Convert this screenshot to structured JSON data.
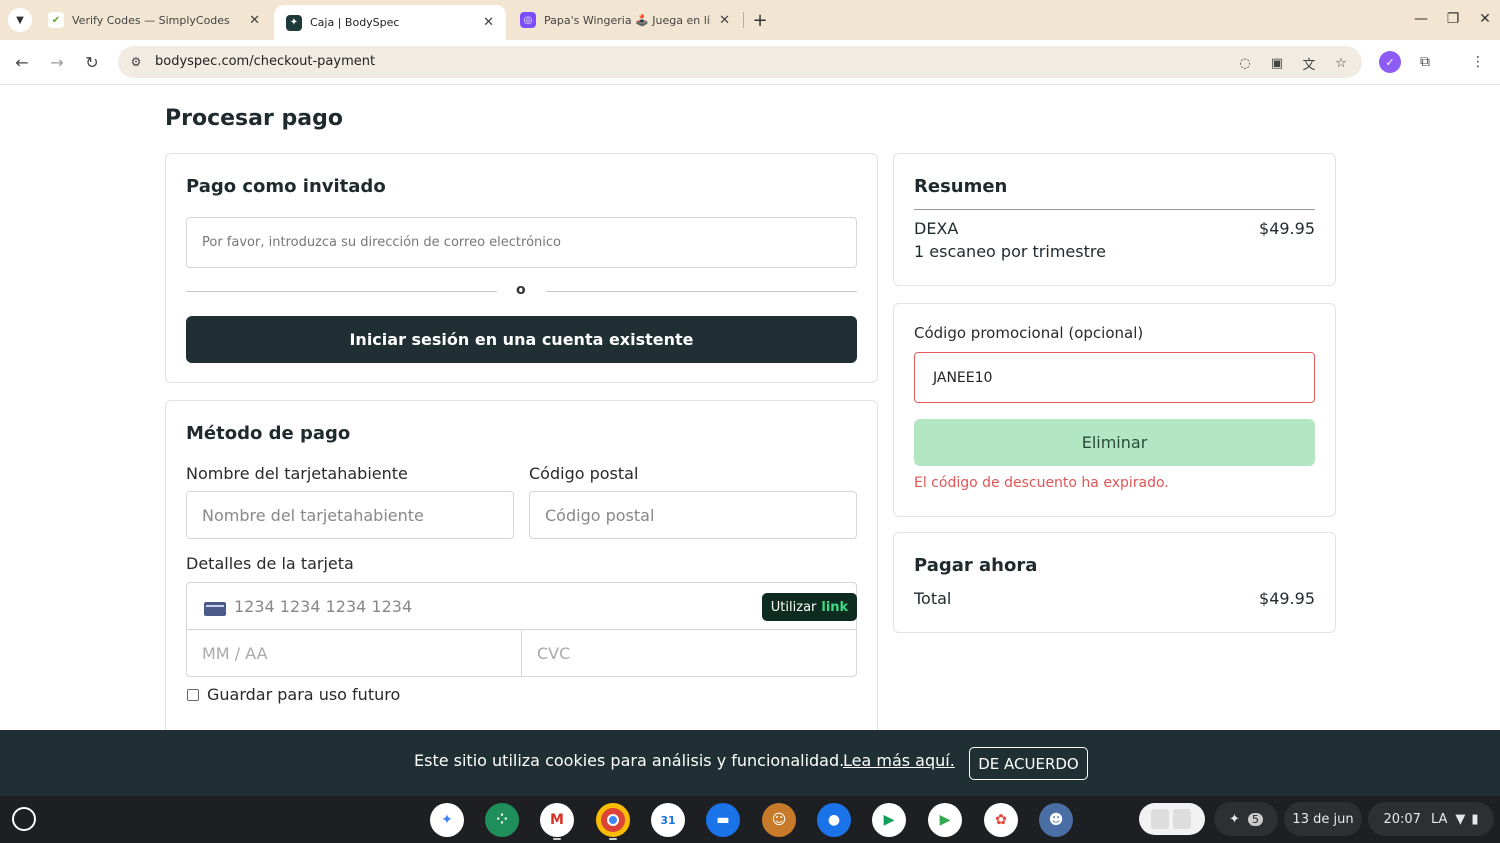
{
  "browser": {
    "tabs": [
      {
        "title": "Verify Codes — SimplyCodes",
        "icon": "simplycodes-icon",
        "icon_color": "#8bc34a",
        "active": false
      },
      {
        "title": "Caja | BodySpec",
        "icon": "bodyspec-icon",
        "icon_color": "#1f3a3a",
        "active": true
      },
      {
        "title": "Papa's Wingeria 🕹️ Juega en línea",
        "icon": "game-icon",
        "icon_color": "#7c4dff",
        "active": false
      }
    ],
    "url": "bodyspec.com/checkout-payment"
  },
  "page": {
    "title": "Procesar pago",
    "guest": {
      "title": "Pago como invitado",
      "email_placeholder": "Por favor, introduzca su dirección de correo electrónico",
      "or": "o",
      "login_button": "Iniciar sesión en una cuenta existente"
    },
    "payment": {
      "title": "Método de pago",
      "cardholder_label": "Nombre del tarjetahabiente",
      "cardholder_placeholder": "Nombre del tarjetahabiente",
      "postal_label": "Código postal",
      "postal_placeholder": "Código postal",
      "card_details_label": "Detalles de la tarjeta",
      "card_number_placeholder": "1234 1234 1234 1234",
      "link_button_prefix": "Utilizar",
      "link_button_word": "link",
      "expiry_placeholder": "MM / AA",
      "cvc_placeholder": "CVC",
      "save_label": "Guardar para uso futuro"
    },
    "summary": {
      "title": "Resumen",
      "item_name": "DEXA",
      "item_desc": "1 escaneo por trimestre",
      "item_price": "$49.95"
    },
    "promo": {
      "label": "Código promocional (opcional)",
      "value": "JANEE10",
      "remove_button": "Eliminar",
      "error": "El código de descuento ha expirado."
    },
    "pay_now": {
      "title": "Pagar ahora",
      "total_label": "Total",
      "total_value": "$49.95"
    }
  },
  "cookie_banner": {
    "text": "Este sitio utiliza cookies para análisis y funcionalidad.",
    "link": "Lea más aquí.",
    "accept": "DE ACUERDO"
  },
  "shelf": {
    "notifications_count": "5",
    "date": "13 de jun",
    "time": "20:07",
    "locale": "LA"
  }
}
